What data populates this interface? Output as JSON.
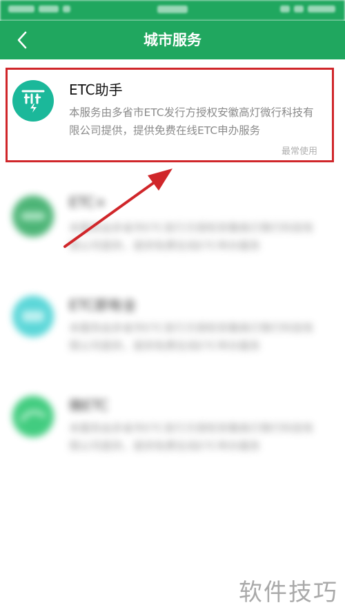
{
  "nav": {
    "title": "城市服务"
  },
  "colors": {
    "brand_green": "#20a75f",
    "highlight_red": "#d0262a",
    "etc_teal": "#1bb89a"
  },
  "services": [
    {
      "icon": "etc-helper-logo-icon",
      "name": "ETC助手",
      "description": "本服务由多省市ETC发行方授权安徽高灯微行科技有限公司提供，提供免费在线ETC申办服务",
      "usage_tag": "最常使用"
    },
    {
      "icon": "etc-logo-icon",
      "name": "ETC+",
      "description": "本服务由多省市ETC发行方授权安徽高灯微行科技有限公司提供，提供免费在线ETC申办服务"
    },
    {
      "icon": "etc-recharge-logo-icon",
      "name": "ETC即有全",
      "description": "本服务由多省市ETC发行方授权安徽高灯微行科技有限公司提供，提供免费在线ETC申办服务"
    },
    {
      "icon": "micro-etc-logo-icon",
      "name": "微ETC",
      "description": "本服务由多省市ETC发行方授权安徽高灯微行科技有限公司提供，提供免费在线ETC申办服务"
    }
  ],
  "watermark": "软件技巧"
}
